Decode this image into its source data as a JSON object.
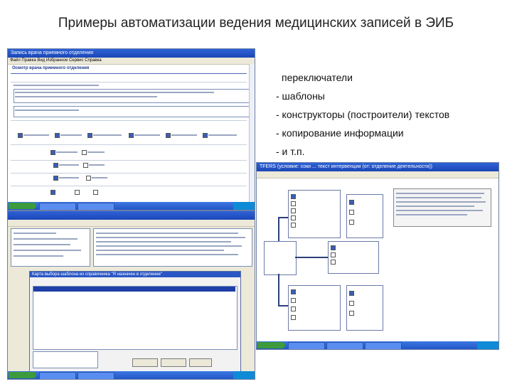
{
  "slide": {
    "title": "Примеры автоматизации ведения медицинских записей в ЭИБ",
    "bullets": [
      "переключатели",
      "- шаблоны",
      "- конструкторы (построители) текстов",
      "- копирование информации",
      "- и т.п."
    ]
  },
  "screenshot1": {
    "title": "Запись  врача приемного отделения",
    "menu": "Файл  Правка  Вид  Избранное  Сервис  Справка",
    "section_title": "Осмотр врача приемного отделения"
  },
  "screenshot2": {
    "title": "Карта выбора шаблона из справочника \"Я назначен в отделение\""
  },
  "screenshot3": {
    "title": "TFERS  (условие: соки ... текст интервенции (от: отделение деятельности))"
  }
}
